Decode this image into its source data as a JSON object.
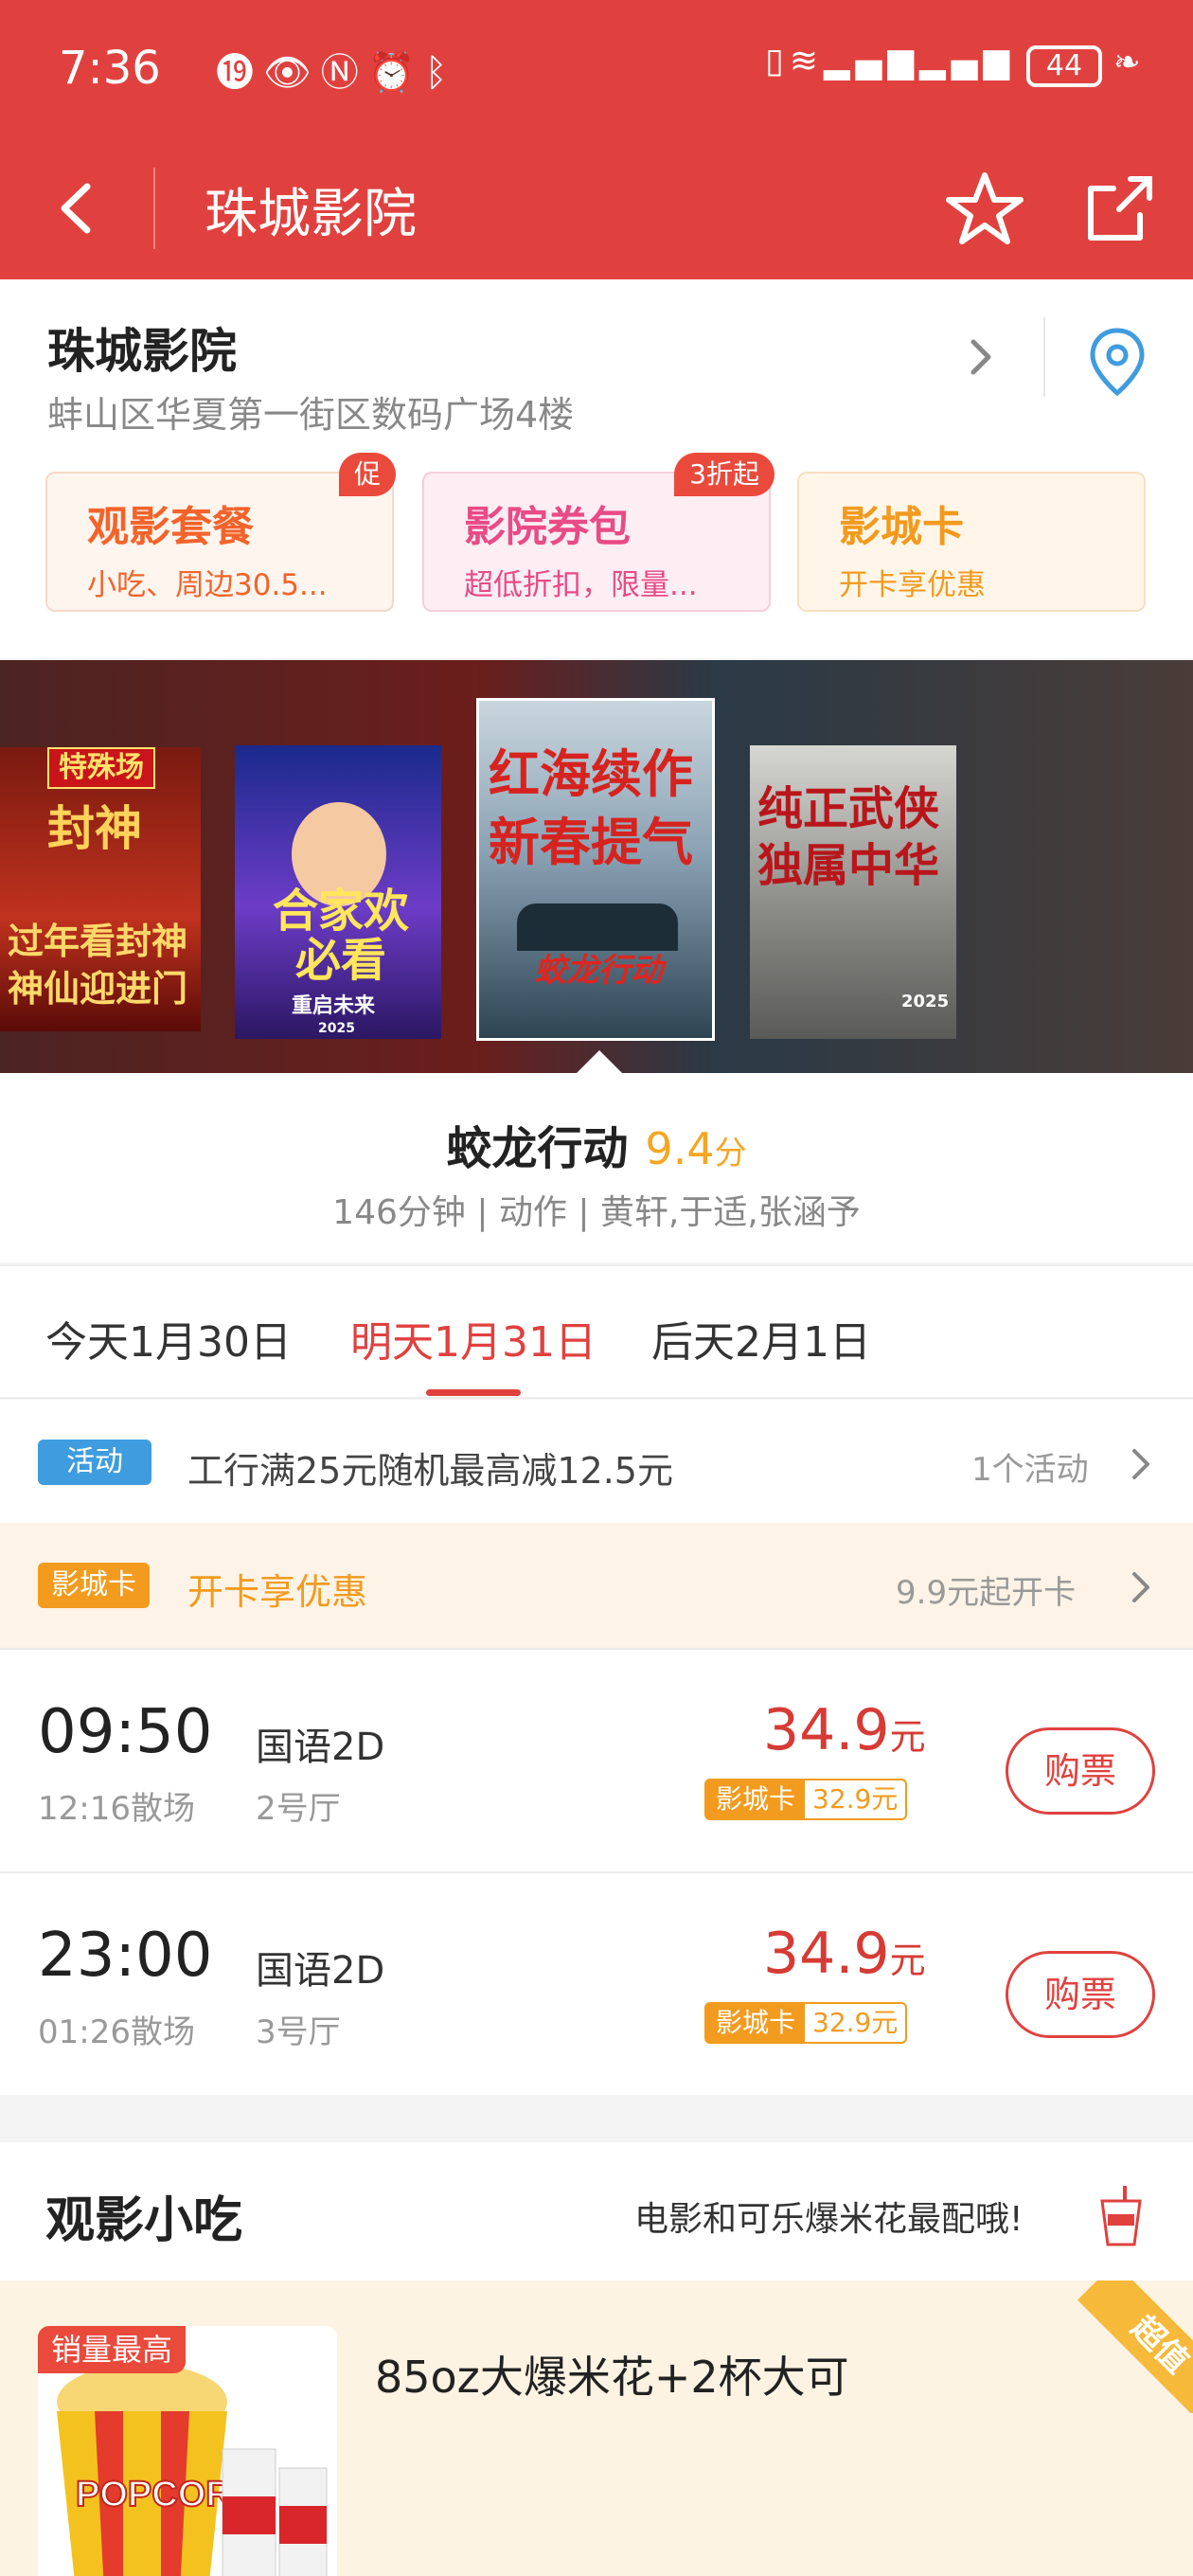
{
  "status_bar": {
    "time": "7:36",
    "left_icons": [
      "notification-badge-icon",
      "eye-icon",
      "nfc-icon",
      "alarm-icon",
      "bluetooth-icon"
    ],
    "right_icons": [
      "vibrate-icon",
      "wifi-icon",
      "signal-icon",
      "signal-icon"
    ],
    "battery": "44"
  },
  "nav": {
    "title": "珠城影院"
  },
  "cinema": {
    "name": "珠城影院",
    "address": "蚌山区华夏第一街区数码广场4楼",
    "cards": [
      {
        "title": "观影套餐",
        "subtitle": "小吃、周边30.5...",
        "badge": "促"
      },
      {
        "title": "影院券包",
        "subtitle": "超低折扣，限量...",
        "badge": "3折起"
      },
      {
        "title": "影城卡",
        "subtitle": "开卡享优惠",
        "badge": ""
      }
    ]
  },
  "posters": [
    {
      "tag": "特殊场",
      "line1": "过年看封神",
      "line2": "神仙迎进门",
      "logo": "封神"
    },
    {
      "line1": "合家欢",
      "line2": "必看",
      "foot": "重启未来",
      "year": "2025"
    },
    {
      "line1": "红海续作",
      "line2": "新春提气",
      "logo": "蛟龙行动"
    },
    {
      "line1": "纯正武侠",
      "line2": "独属中华",
      "year": "2025"
    }
  ],
  "movie": {
    "title": "蛟龙行动",
    "score": "9.4",
    "score_unit": "分",
    "meta": "146分钟 | 动作 | 黄轩,于适,张涵予"
  },
  "date_tabs": [
    {
      "label": "今天1月30日",
      "active": false
    },
    {
      "label": "明天1月31日",
      "active": true
    },
    {
      "label": "后天2月1日",
      "active": false
    }
  ],
  "promo": {
    "tag": "活动",
    "text": "工行满25元随机最高减12.5元",
    "right": "1个活动"
  },
  "card_row": {
    "tag": "影城卡",
    "text": "开卡享优惠",
    "right": "9.9元起开卡"
  },
  "showtimes": [
    {
      "time": "09:50",
      "end": "12:16散场",
      "lang": "国语2D",
      "hall": "2号厅",
      "price": "34.9",
      "price_unit": "元",
      "card_label": "影城卡",
      "card_price": "32.9元",
      "buy": "购票"
    },
    {
      "time": "23:00",
      "end": "01:26散场",
      "lang": "国语2D",
      "hall": "3号厅",
      "price": "34.9",
      "price_unit": "元",
      "card_label": "影城卡",
      "card_price": "32.9元",
      "buy": "购票"
    }
  ],
  "snacks": {
    "title": "观影小吃",
    "slogan": "电影和可乐爆米花最配哦!",
    "item": {
      "badge": "销量最高",
      "name": "85oz大爆米花+2杯大可",
      "corner": "超值",
      "image_text": "POPCORN"
    }
  },
  "colors": {
    "primary": "#e0413f",
    "score": "#f5a623",
    "card_orange": "#f29b1e",
    "promo_blue": "#3f9cde"
  }
}
